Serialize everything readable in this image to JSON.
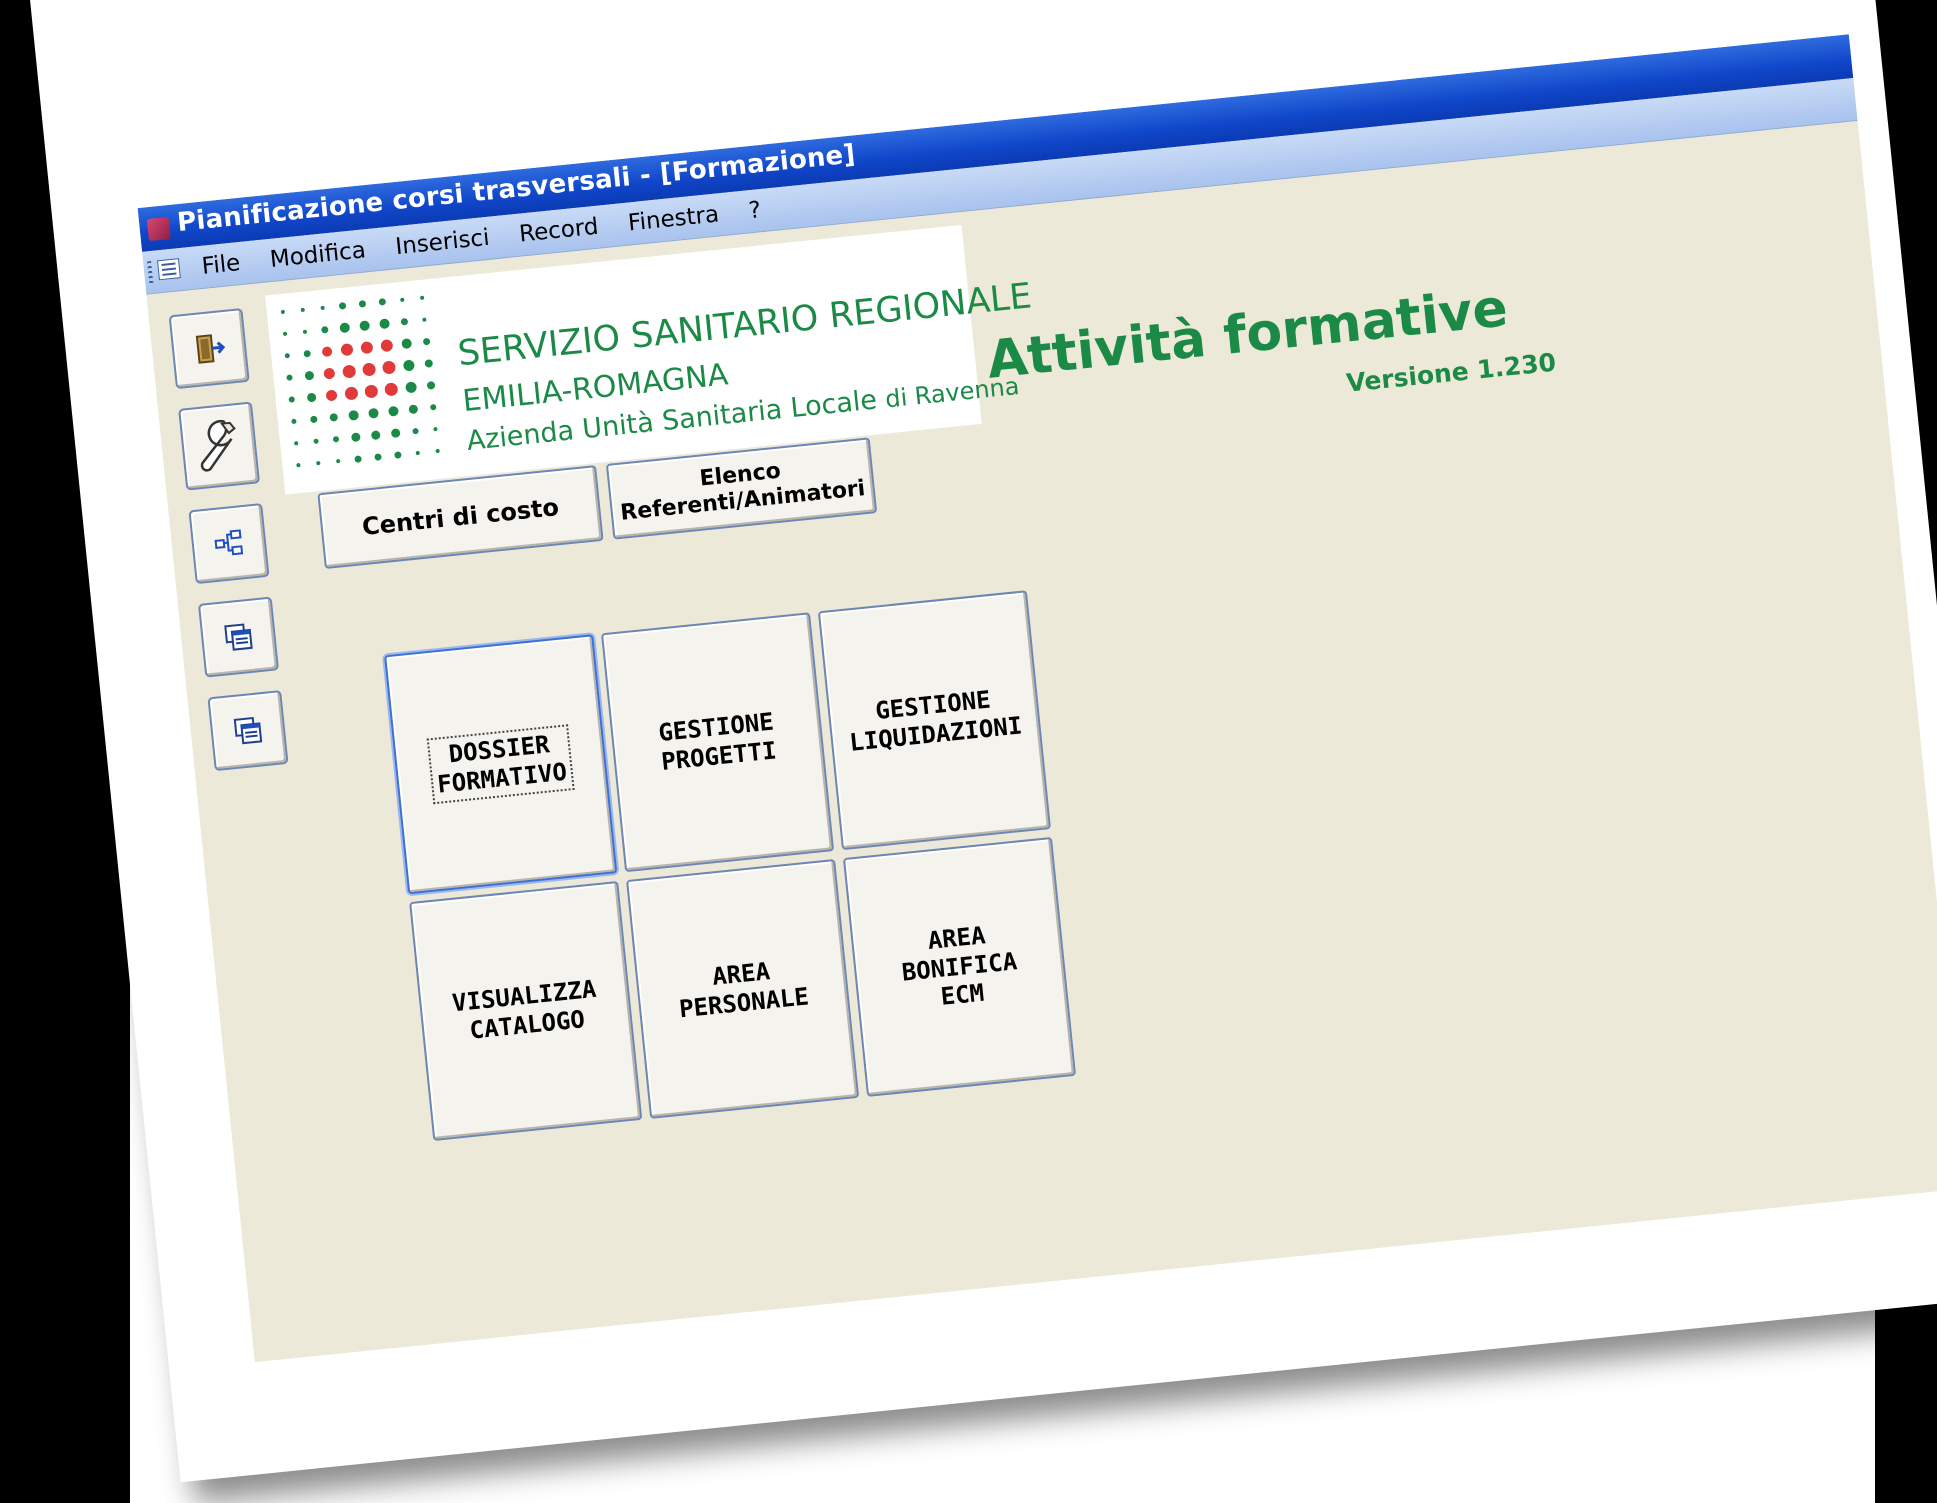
{
  "window": {
    "title": "Pianificazione corsi trasversali - [Formazione]"
  },
  "menubar": {
    "items": [
      "File",
      "Modifica",
      "Inserisci",
      "Record",
      "Finestra",
      "?"
    ]
  },
  "toolbar": {
    "items": [
      {
        "name": "exit-icon"
      },
      {
        "name": "wrench-icon"
      },
      {
        "name": "hierarchy-icon"
      },
      {
        "name": "forms-icon"
      },
      {
        "name": "forms-icon"
      }
    ]
  },
  "logo": {
    "line1": "SERVIZIO SANITARIO REGIONALE",
    "line2": "EMILIA-ROMAGNA",
    "line3": "Azienda Unità Sanitaria Locale",
    "line3_suffix": "di Ravenna",
    "colors": {
      "green": "#1c8a47",
      "red": "#e03a3a"
    }
  },
  "header": {
    "title": "Attività formative",
    "version": "Versione 1.230"
  },
  "buttons": {
    "centri": "Centri di costo",
    "referenti": "Elenco\nReferenti/Animatori",
    "dossier": "DOSSIER\nFORMATIVO",
    "progetti": "GESTIONE\nPROGETTI",
    "liquidazioni": "GESTIONE\nLIQUIDAZIONI",
    "catalogo": "VISUALIZZA\nCATALOGO",
    "personale": "AREA\nPERSONALE",
    "bonifica": "AREA\nBONIFICA\nECM"
  }
}
